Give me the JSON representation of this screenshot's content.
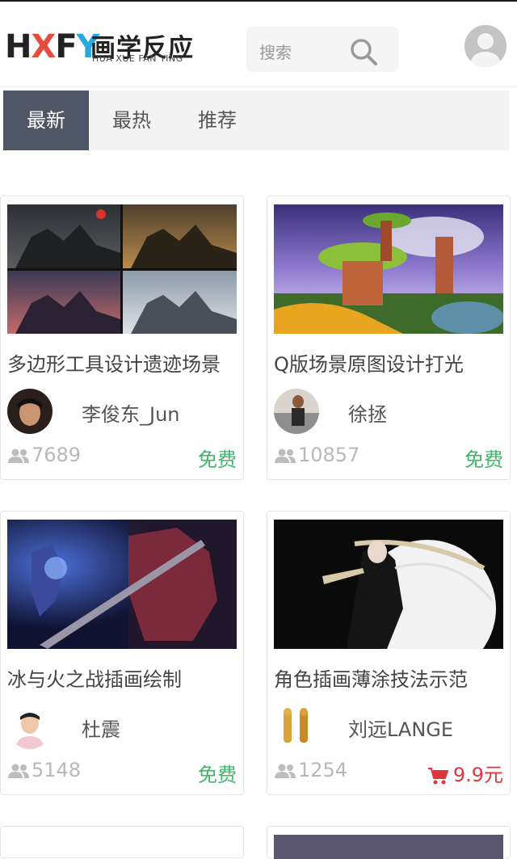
{
  "header": {
    "logo_mark": "HXFY",
    "logo_cn": "画学反应",
    "logo_en": "HUA XUE FAN YING",
    "search_placeholder": "搜索",
    "accent_colors": [
      "#e84c3d",
      "#2aa8e0"
    ]
  },
  "tabs": [
    {
      "label": "最新",
      "active": true
    },
    {
      "label": "最热",
      "active": false
    },
    {
      "label": "推荐",
      "active": false
    }
  ],
  "courses": [
    {
      "title": "多边形工具设计遗迹场景",
      "author": "李俊东_Jun",
      "count": "7689",
      "price": "免费",
      "price_type": "free"
    },
    {
      "title": "Q版场景原图设计打光",
      "author": "徐拯",
      "count": "10857",
      "price": "免费",
      "price_type": "free"
    },
    {
      "title": "冰与火之战插画绘制",
      "author": "杜震",
      "count": "5148",
      "price": "免费",
      "price_type": "free"
    },
    {
      "title": "角色插画薄涂技法示范",
      "author": "刘远LANGE",
      "count": "1254",
      "price": "9.9元",
      "price_type": "paid"
    }
  ],
  "colors": {
    "free": "#3cb86a",
    "paid": "#e0353b",
    "tab_active": "#4f5666"
  }
}
